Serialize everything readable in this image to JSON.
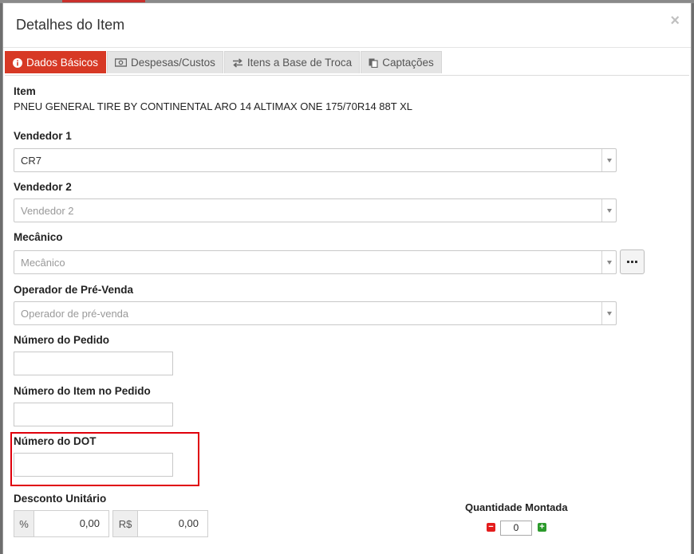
{
  "modal": {
    "title": "Detalhes do Item",
    "close": "×"
  },
  "tabs": [
    {
      "label": "Dados Básicos",
      "icon": "info-circle-icon",
      "active": true
    },
    {
      "label": "Despesas/Custos",
      "icon": "money-icon",
      "active": false
    },
    {
      "label": "Itens a Base de Troca",
      "icon": "exchange-icon",
      "active": false
    },
    {
      "label": "Captações",
      "icon": "paste-icon",
      "active": false
    }
  ],
  "item": {
    "label": "Item",
    "value": "PNEU GENERAL TIRE BY CONTINENTAL ARO 14 ALTIMAX ONE 175/70R14 88T XL"
  },
  "vendedor1": {
    "label": "Vendedor 1",
    "value": "CR7"
  },
  "vendedor2": {
    "label": "Vendedor 2",
    "placeholder": "Vendedor 2"
  },
  "mecanico": {
    "label": "Mecânico",
    "placeholder": "Mecânico"
  },
  "operador": {
    "label": "Operador de Pré-Venda",
    "placeholder": "Operador de pré-venda"
  },
  "numero_pedido": {
    "label": "Número do Pedido",
    "value": ""
  },
  "numero_item_pedido": {
    "label": "Número do Item no Pedido",
    "value": ""
  },
  "numero_dot": {
    "label": "Número do DOT",
    "value": ""
  },
  "desconto": {
    "label": "Desconto Unitário",
    "percent_addon": "%",
    "percent_value": "0,00",
    "currency_addon": "R$",
    "currency_value": "0,00"
  },
  "quantidade": {
    "label": "Quantidade Montada",
    "value": "0"
  },
  "colors": {
    "active_tab": "#d73925",
    "highlight": "#e0000b",
    "minus": "#e41c1c",
    "plus": "#2c9a2c"
  }
}
